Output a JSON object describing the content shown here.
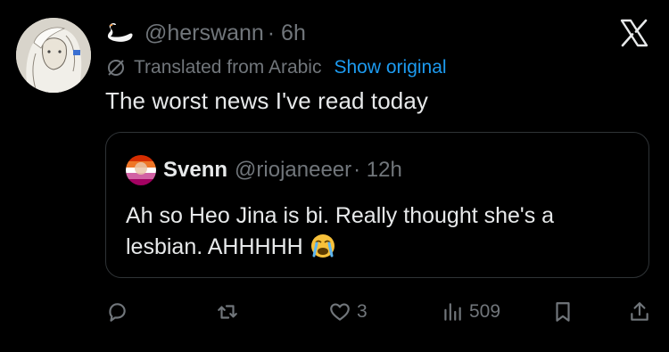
{
  "tweet": {
    "handle": "@herswann",
    "time": "· 6h",
    "translated_label": "Translated from Arabic",
    "show_original": "Show original",
    "text": "The worst news I've read today"
  },
  "quote": {
    "name": "Svenn",
    "handle": "@riojaneeer",
    "time": "· 12h",
    "text": "Ah so Heo Jina is bi. Really thought she's a lesbian. AHHHHH"
  },
  "actions": {
    "likes": "3",
    "views": "509"
  },
  "colors": {
    "background": "#000000",
    "text": "#e7e9ea",
    "muted": "#71767b",
    "link": "#1d9bf0",
    "border": "#2f3336"
  }
}
